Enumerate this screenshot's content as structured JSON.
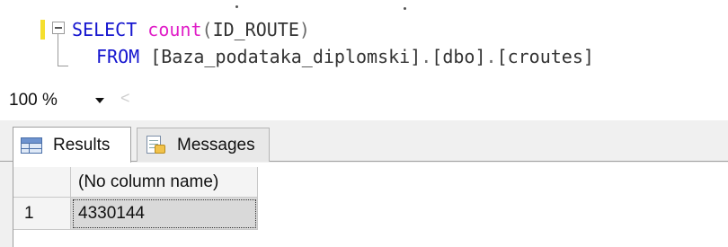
{
  "editor": {
    "line1": {
      "keyword": "SELECT",
      "function": "count",
      "open_paren": "(",
      "argument": "ID_ROUTE",
      "close_paren": ")"
    },
    "line2": {
      "keyword": "FROM",
      "object": "[Baza_podataka_diplomski]",
      "dot1": ".",
      "schema": "[dbo]",
      "dot2": ".",
      "table": "[croutes]"
    }
  },
  "zoom": {
    "value": "100 %",
    "scroll_left_glyph": "<"
  },
  "tabs": [
    {
      "label": "Results",
      "icon": "grid-icon",
      "selected": true
    },
    {
      "label": "Messages",
      "icon": "messages-icon",
      "selected": false
    }
  ],
  "results_grid": {
    "columns": [
      "(No column name)"
    ],
    "rows": [
      {
        "row_number": "1",
        "cells": [
          "4330144"
        ]
      }
    ]
  },
  "colors": {
    "keyword": "#1515cf",
    "function": "#e01ec7",
    "change_marker": "#f5df2e",
    "selected_cell": "#d9d9d9"
  }
}
